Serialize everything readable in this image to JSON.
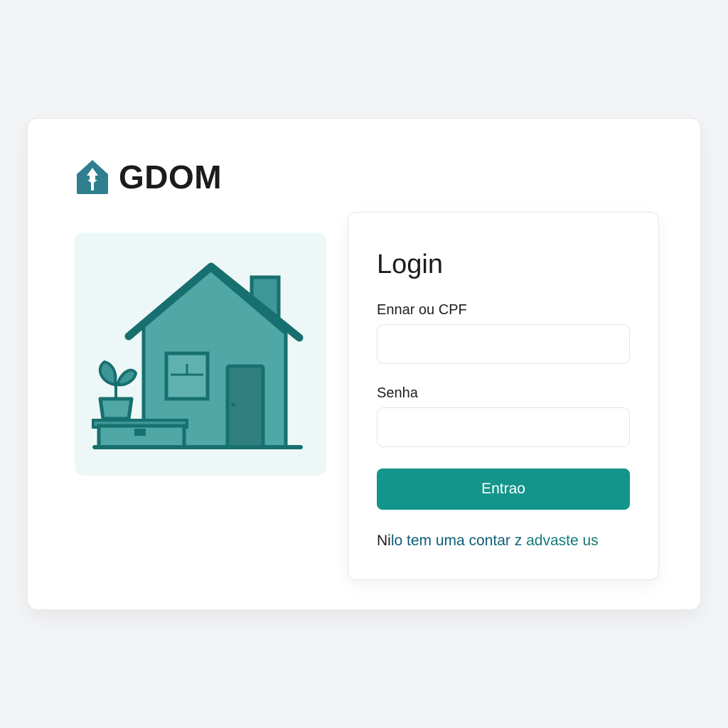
{
  "brand": {
    "name": "GDOM",
    "logo_icon": "house-logo-icon"
  },
  "illustration": {
    "icon": "house-illustration"
  },
  "login": {
    "title": "Login",
    "user_label": "Ennar ou CPF",
    "user_value": "",
    "pass_label": "Senha",
    "pass_value": "",
    "submit_label": "Entrao",
    "signup_prefix": "Ni",
    "signup_text": "lo tem uma contar z ",
    "signup_link": "advaste us"
  },
  "colors": {
    "accent": "#13958b",
    "link": "#117a78",
    "logo": "#2f7f8e",
    "illustration_bg": "#eef7f7",
    "house_fill": "#4fa7a6",
    "house_stroke": "#17706f"
  }
}
